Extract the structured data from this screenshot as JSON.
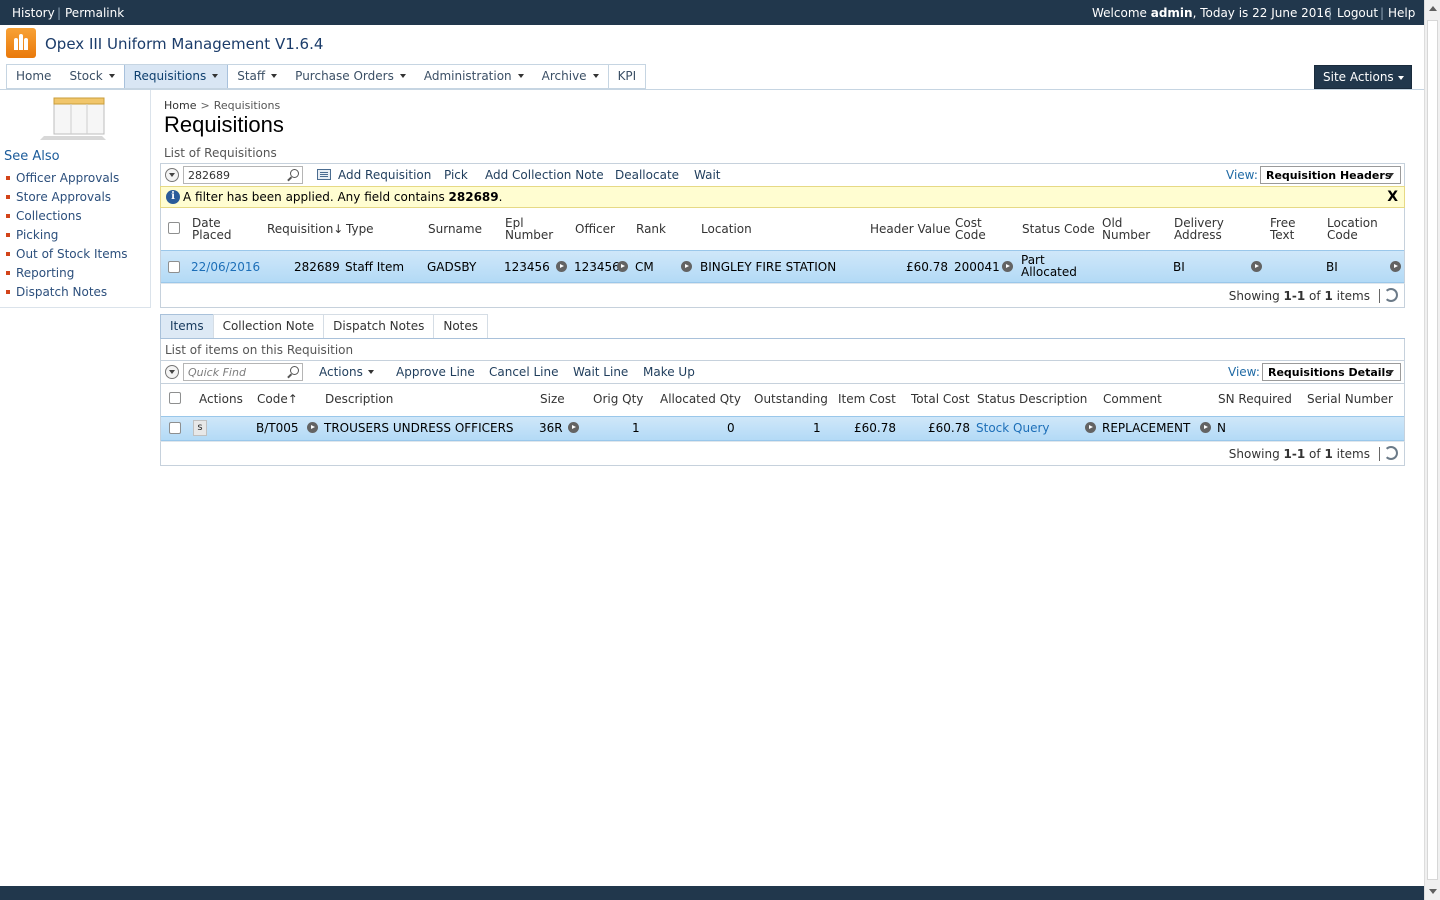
{
  "topbar": {
    "history": "History",
    "permalink": "Permalink",
    "welcome_prefix": "Welcome",
    "user": "admin",
    "date_text": ", Today is 22 June 2016",
    "logout": "Logout",
    "help": "Help"
  },
  "site": {
    "title": "Opex III Uniform Management V1.6.4"
  },
  "nav": {
    "items": [
      "Home",
      "Stock",
      "Requisitions",
      "Staff",
      "Purchase Orders",
      "Administration",
      "Archive",
      "KPI"
    ],
    "site_actions": "Site Actions"
  },
  "sidebar": {
    "heading": "See Also",
    "items": [
      "Officer Approvals",
      "Store Approvals",
      "Collections",
      "Picking",
      "Out of Stock Items",
      "Reporting",
      "Dispatch Notes"
    ]
  },
  "breadcrumb": {
    "home": "Home",
    "sep": ">",
    "current": "Requisitions"
  },
  "page": {
    "title": "Requisitions",
    "list_caption": "List of Requisitions"
  },
  "req_toolbar": {
    "search_value": "282689",
    "actions": [
      "Add Requisition",
      "Pick",
      "Add Collection Note",
      "Deallocate",
      "Wait"
    ],
    "view_label": "View:",
    "view_value": "Requisition Headers"
  },
  "filter": {
    "prefix": "A filter has been applied. Any field contains ",
    "value": "282689",
    "suffix": ".",
    "close": "X"
  },
  "req_grid": {
    "headers": {
      "date_placed": [
        "Date",
        "Placed"
      ],
      "requisition": "Requisition↓",
      "type": "Type",
      "surname": "Surname",
      "epl_number": [
        "Epl",
        "Number"
      ],
      "officer": "Officer",
      "rank": "Rank",
      "location": "Location",
      "header_value": "Header Value",
      "cost_code": [
        "Cost",
        "Code"
      ],
      "status_code": "Status Code",
      "old_number": [
        "Old",
        "Number"
      ],
      "delivery_address": [
        "Delivery",
        "Address"
      ],
      "free_text": [
        "Free",
        "Text"
      ],
      "location_code": [
        "Location",
        "Code"
      ]
    },
    "row": {
      "date_placed": "22/06/2016",
      "requisition": "282689",
      "type": "Staff Item",
      "surname": "GADSBY",
      "epl_number": "123456",
      "officer": "123456",
      "rank": "CM",
      "location": "BINGLEY FIRE STATION",
      "header_value": "£60.78",
      "cost_code": "200041",
      "status_code": [
        "Part",
        "Allocated"
      ],
      "delivery_address": "BI",
      "location_code": "BI"
    },
    "footer": {
      "showing": "Showing",
      "range": "1-1",
      "of": "of",
      "count": "1",
      "items": "items"
    }
  },
  "tabs": [
    "Items",
    "Collection Note",
    "Dispatch Notes",
    "Notes"
  ],
  "items_caption": "List of items on this Requisition",
  "items_toolbar": {
    "search_placeholder": "Quick Find",
    "actions_menu": "Actions",
    "actions": [
      "Approve Line",
      "Cancel Line",
      "Wait Line",
      "Make Up"
    ],
    "view_label": "View:",
    "view_value": "Requisitions Details"
  },
  "items_grid": {
    "headers": {
      "actions": "Actions",
      "code": "Code↑",
      "description": "Description",
      "size": "Size",
      "orig_qty": "Orig Qty",
      "allocated_qty": "Allocated Qty",
      "outstanding": "Outstanding",
      "item_cost": "Item Cost",
      "total_cost": "Total Cost",
      "status_description": "Status Description",
      "comment": "Comment",
      "sn_required": "SN Required",
      "serial_number": "Serial Number"
    },
    "row": {
      "action_btn": "s",
      "code": "B/T005",
      "description": "TROUSERS UNDRESS OFFICERS",
      "size": "36R",
      "orig_qty": "1",
      "allocated_qty": "0",
      "outstanding": "1",
      "item_cost": "£60.78",
      "total_cost": "£60.78",
      "status_description": "Stock Query",
      "comment": "REPLACEMENT",
      "sn_required": "N"
    },
    "footer": {
      "showing": "Showing",
      "range": "1-1",
      "of": "of",
      "count": "1",
      "items": "items"
    }
  },
  "colors": {
    "topbar": "#21374c",
    "row_selected": "#b3daf6",
    "link": "#1d6fb8",
    "filter_bg": "#fffdd1",
    "logo": "#f39019"
  }
}
